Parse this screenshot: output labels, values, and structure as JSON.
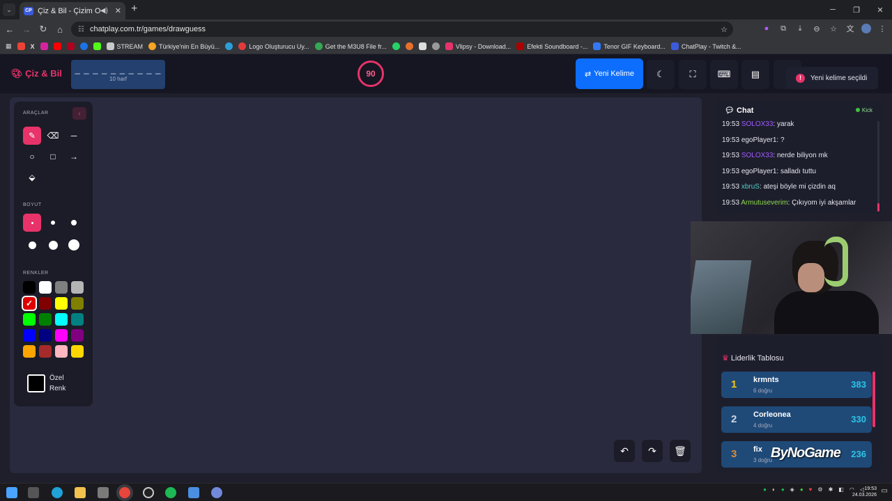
{
  "browser": {
    "tab_title": "Çiz & Bil - Çizim Oyunu",
    "tab_favicon": "CP",
    "url": "chatplay.com.tr/games/drawguess",
    "bookmarks": [
      "STREAM",
      "Türkiye'nin En Büyü...",
      "Logo Oluşturucu Uy...",
      "Get the M3U8 File fr...",
      "Vlipsy - Download...",
      "Efekti Soundboard -...",
      "Tenor GIF Keyboard...",
      "ChatPlay - Twitch &..."
    ]
  },
  "header": {
    "logo": "Çiz & Bil",
    "word_underscores": "_ _ _ _ _ _ _ _ _ _",
    "word_hint": "10 harf",
    "timer": "90",
    "new_word_label": "Yeni Kelime"
  },
  "toast": {
    "message": "Yeni kelime seçildi"
  },
  "tools": {
    "section_tools": "ARAÇLAR",
    "section_size": "BOYUT",
    "section_colors": "RENKLER",
    "custom_line1": "Özel",
    "custom_line2": "Renk",
    "colors": [
      [
        "#000000",
        "#ffffff",
        "#808080",
        "#b5b5b5"
      ],
      [
        "#e00000",
        "#800000",
        "#ffff00",
        "#808000"
      ],
      [
        "#00ff00",
        "#008000",
        "#00ffff",
        "#008080"
      ],
      [
        "#0000ff",
        "#000080",
        "#ff00ff",
        "#800080"
      ],
      [
        "#ffa500",
        "#a52a2a",
        "#ffb6c1",
        "#ffd700"
      ]
    ]
  },
  "chat": {
    "title": "Chat",
    "platform": "Kick",
    "messages": [
      {
        "time": "19:53",
        "user": "SOLOX33",
        "color": "#a259ff",
        "text": ": yarak"
      },
      {
        "time": "19:53",
        "user": "egoPlayer1",
        "color": "#e6e6ee",
        "text": ": ?"
      },
      {
        "time": "19:53",
        "user": "SOLOX33",
        "color": "#a259ff",
        "text": ": nerde biliyon mk"
      },
      {
        "time": "19:53",
        "user": "egoPlayer1",
        "color": "#e6e6ee",
        "text": ": salladı tuttu"
      },
      {
        "time": "19:53",
        "user": "xbruS",
        "color": "#4fd1c5",
        "text": ": ateşi böyle mi çizdin aq"
      },
      {
        "time": "19:53",
        "user": "Armutuseverim",
        "color": "#8ddc4a",
        "text": ": Çıkıyom iyi akşamlar"
      }
    ]
  },
  "leaderboard": {
    "title": "Liderlik Tablosu",
    "rows": [
      {
        "rank": "1",
        "rank_color": "#f5c518",
        "name": "krmnts",
        "sub": "6 doğru",
        "score": "383"
      },
      {
        "rank": "2",
        "rank_color": "#cfd6e6",
        "name": "Corleonea",
        "sub": "4 doğru",
        "score": "330"
      },
      {
        "rank": "3",
        "rank_color": "#d98b3a",
        "name": "fix",
        "sub": "3 doğru",
        "score": "236"
      }
    ]
  },
  "watermark": "ByNoGame",
  "clock": {
    "time": "19:53",
    "date": "24.03.2026"
  }
}
